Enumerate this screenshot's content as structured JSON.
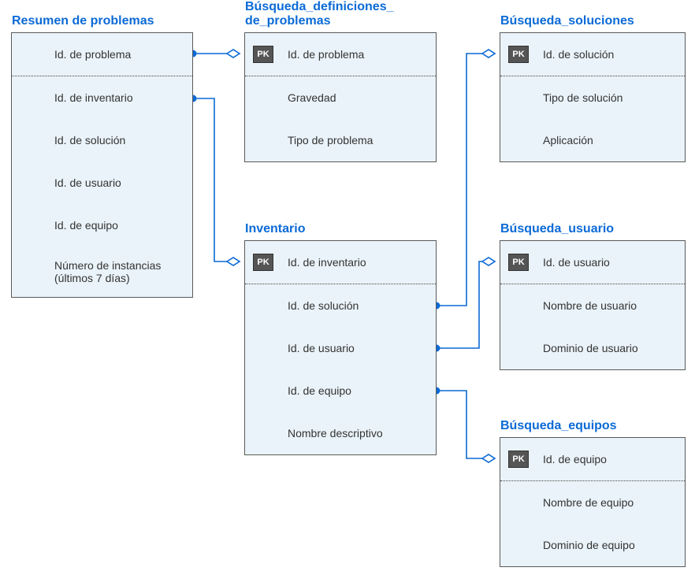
{
  "pk_label": "PK",
  "entities": {
    "resumen": {
      "title": "Resumen de problemas",
      "rows": [
        "Id. de problema",
        "Id. de inventario",
        "Id. de solución",
        "Id. de usuario",
        "Id. de equipo",
        "Número de instancias (últimos 7 días)"
      ]
    },
    "defs": {
      "title": "Búsqueda_definiciones_\nde_problemas",
      "rows": [
        "Id. de problema",
        "Gravedad",
        "Tipo de problema"
      ]
    },
    "soluciones": {
      "title": "Búsqueda_soluciones",
      "rows": [
        "Id. de solución",
        "Tipo de solución",
        "Aplicación"
      ]
    },
    "inventario": {
      "title": "Inventario",
      "rows": [
        "Id. de inventario",
        "Id. de solución",
        "Id. de usuario",
        "Id. de equipo",
        "Nombre descriptivo"
      ]
    },
    "usuario": {
      "title": "Búsqueda_usuario",
      "rows": [
        "Id. de usuario",
        "Nombre de usuario",
        "Dominio de usuario"
      ]
    },
    "equipos": {
      "title": "Búsqueda_equipos",
      "rows": [
        "Id. de equipo",
        "Nombre de equipo",
        "Dominio de equipo"
      ]
    }
  },
  "relationships": [
    {
      "from": "resumen.Id. de problema",
      "to": "defs.Id. de problema",
      "type": "one-to-many"
    },
    {
      "from": "resumen.Id. de inventario",
      "to": "inventario.Id. de inventario",
      "type": "one-to-many"
    },
    {
      "from": "inventario.Id. de solución",
      "to": "soluciones.Id. de solución",
      "type": "one-to-many"
    },
    {
      "from": "inventario.Id. de usuario",
      "to": "usuario.Id. de usuario",
      "type": "one-to-many"
    },
    {
      "from": "inventario.Id. de equipo",
      "to": "equipos.Id. de equipo",
      "type": "one-to-many"
    }
  ]
}
